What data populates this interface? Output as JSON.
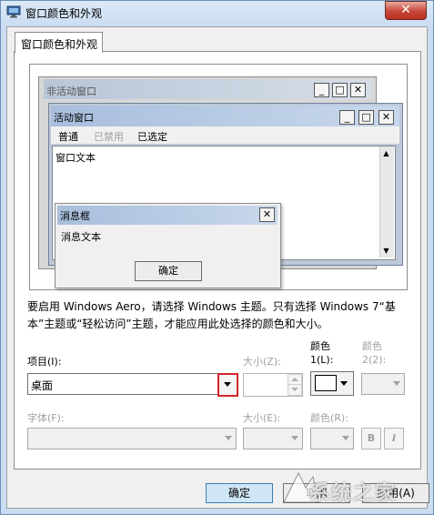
{
  "window": {
    "title": "窗口颜色和外观",
    "close_glyph": "✕"
  },
  "tab": {
    "label": "窗口颜色和外观"
  },
  "preview": {
    "inactive_title": "非活动窗口",
    "active_title": "活动窗口",
    "menu": [
      "普通",
      "已禁用",
      "已选定"
    ],
    "window_text": "窗口文本",
    "msgbox_title": "消息框",
    "msgbox_text": "消息文本",
    "msgbox_ok": "确定",
    "btn_min": "_",
    "btn_max": "□",
    "btn_close": "✕"
  },
  "description": "要启用 Windows Aero，请选择 Windows 主题。只有选择 Windows 7“基本”主题或“轻松访问”主题，才能应用此处选择的颜色和大小。",
  "item": {
    "label": "项目(I):",
    "value": "桌面"
  },
  "item_size": {
    "label": "大小(Z):",
    "value": ""
  },
  "color1": {
    "label_line1": "颜色",
    "label_line2": "1(L):",
    "value": "#ffffff"
  },
  "color2": {
    "label_line1": "颜色",
    "label_line2": "2(2):"
  },
  "font": {
    "label": "字体(F):",
    "value": ""
  },
  "font_size": {
    "label": "大小(E):",
    "value": ""
  },
  "font_color": {
    "label": "颜色(R):"
  },
  "format": {
    "bold": "B",
    "italic": "I"
  },
  "buttons": {
    "ok": "确定",
    "cancel": "取消",
    "apply": "应用(A)"
  },
  "watermark": {
    "text": "系统之家"
  },
  "icons": [
    "display-settings-icon",
    "close-icon",
    "minimize-icon",
    "maximize-icon",
    "dropdown-arrow-icon",
    "spin-up-icon",
    "spin-down-icon",
    "scroll-up-icon",
    "scroll-down-icon"
  ],
  "colors": {
    "title_gradient_start": "#a8bedc",
    "close_red": "#c7473a",
    "highlight_red": "#d3262b",
    "selection_blue": "#cfe6f7"
  }
}
